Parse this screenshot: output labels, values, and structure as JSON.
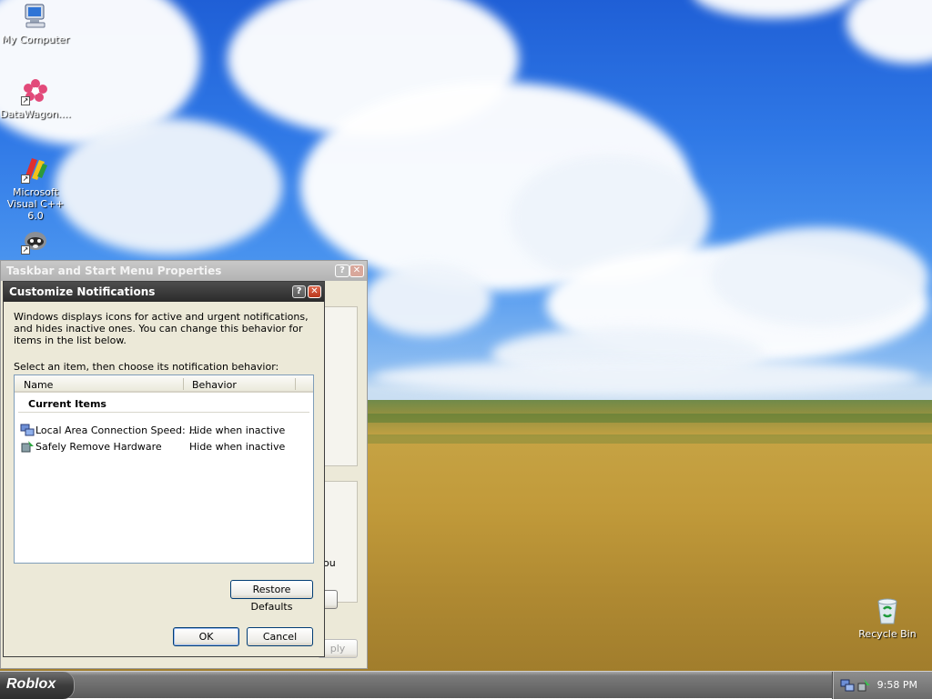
{
  "desktop": {
    "icons": [
      {
        "label": "My Computer",
        "icon": "computer-icon"
      },
      {
        "label": "DataWagon....",
        "icon": "datawagon-icon"
      },
      {
        "label": "Microsoft Visual C++ 6.0",
        "icon": "visual-cpp-icon"
      },
      {
        "label": "",
        "icon": "raccoon-icon"
      },
      {
        "label": "Recycle Bin",
        "icon": "recycle-bin-icon"
      }
    ]
  },
  "background_dialog": {
    "title": "Taskbar and Start Menu Properties",
    "partial_text": "ou",
    "apply_label": "ply"
  },
  "dialog": {
    "title": "Customize Notifications",
    "description": "Windows displays icons for active and urgent notifications, and hides inactive ones. You can change this behavior for items in the list below.",
    "instruction": "Select an item, then choose its notification behavior:",
    "columns": [
      "Name",
      "Behavior"
    ],
    "group_label": "Current Items",
    "items": [
      {
        "name": "Local Area Connection Speed: ...",
        "behavior": "Hide when inactive",
        "icon": "network-connection-icon"
      },
      {
        "name": "Safely Remove Hardware",
        "behavior": "Hide when inactive",
        "icon": "safely-remove-hardware-icon"
      }
    ],
    "restore_defaults_label": "Restore Defaults",
    "ok_label": "OK",
    "cancel_label": "Cancel",
    "help_glyph": "?",
    "close_glyph": "✕"
  },
  "taskbar": {
    "start_label": "Roblox",
    "clock": "9:58 PM"
  }
}
